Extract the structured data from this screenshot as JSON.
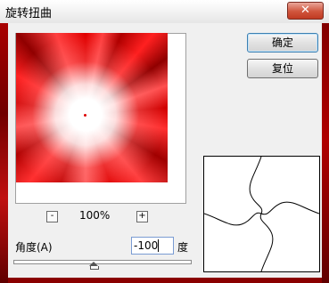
{
  "window": {
    "title": "旋转扭曲",
    "close_icon": "close-x"
  },
  "preview": {
    "zoom": "100%",
    "zoom_out_label": "-",
    "zoom_in_label": "+"
  },
  "buttons": {
    "ok": "确定",
    "reset": "复位"
  },
  "angle": {
    "label": "角度(A)",
    "value": "-100",
    "unit": "度",
    "min": -999,
    "max": 999,
    "slider_fraction": 0.45
  }
}
